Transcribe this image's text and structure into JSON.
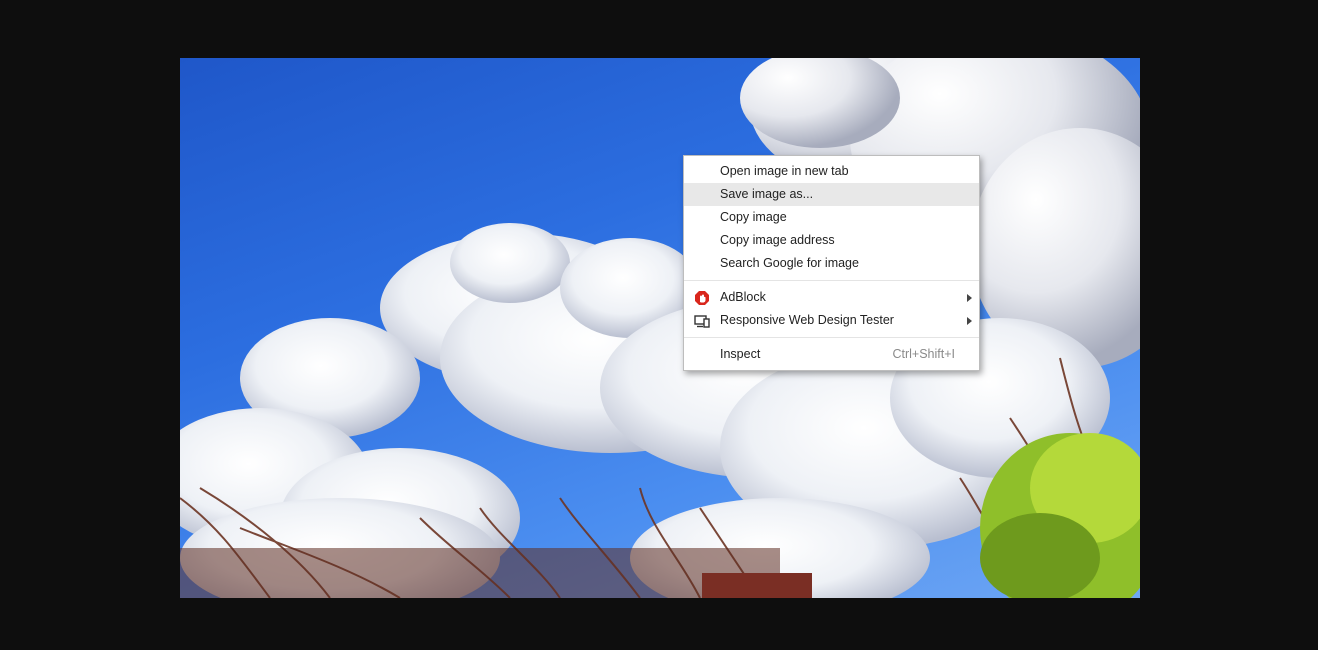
{
  "menu": {
    "items": [
      {
        "label": "Open image in new tab"
      },
      {
        "label": "Save image as..."
      },
      {
        "label": "Copy image"
      },
      {
        "label": "Copy image address"
      },
      {
        "label": "Search Google for image"
      },
      {
        "label": "AdBlock",
        "icon": "adblock-icon"
      },
      {
        "label": "Responsive Web Design Tester",
        "icon": "responsive-tester-icon"
      },
      {
        "label": "Inspect",
        "shortcut": "Ctrl+Shift+I"
      }
    ],
    "highlighted_index": 1
  },
  "colors": {
    "page_background": "#0e0e0e",
    "sky": "#2c6ee0",
    "menu_background": "#ffffff",
    "menu_highlight": "#e8e8e8",
    "adblock_red": "#d9261c"
  }
}
